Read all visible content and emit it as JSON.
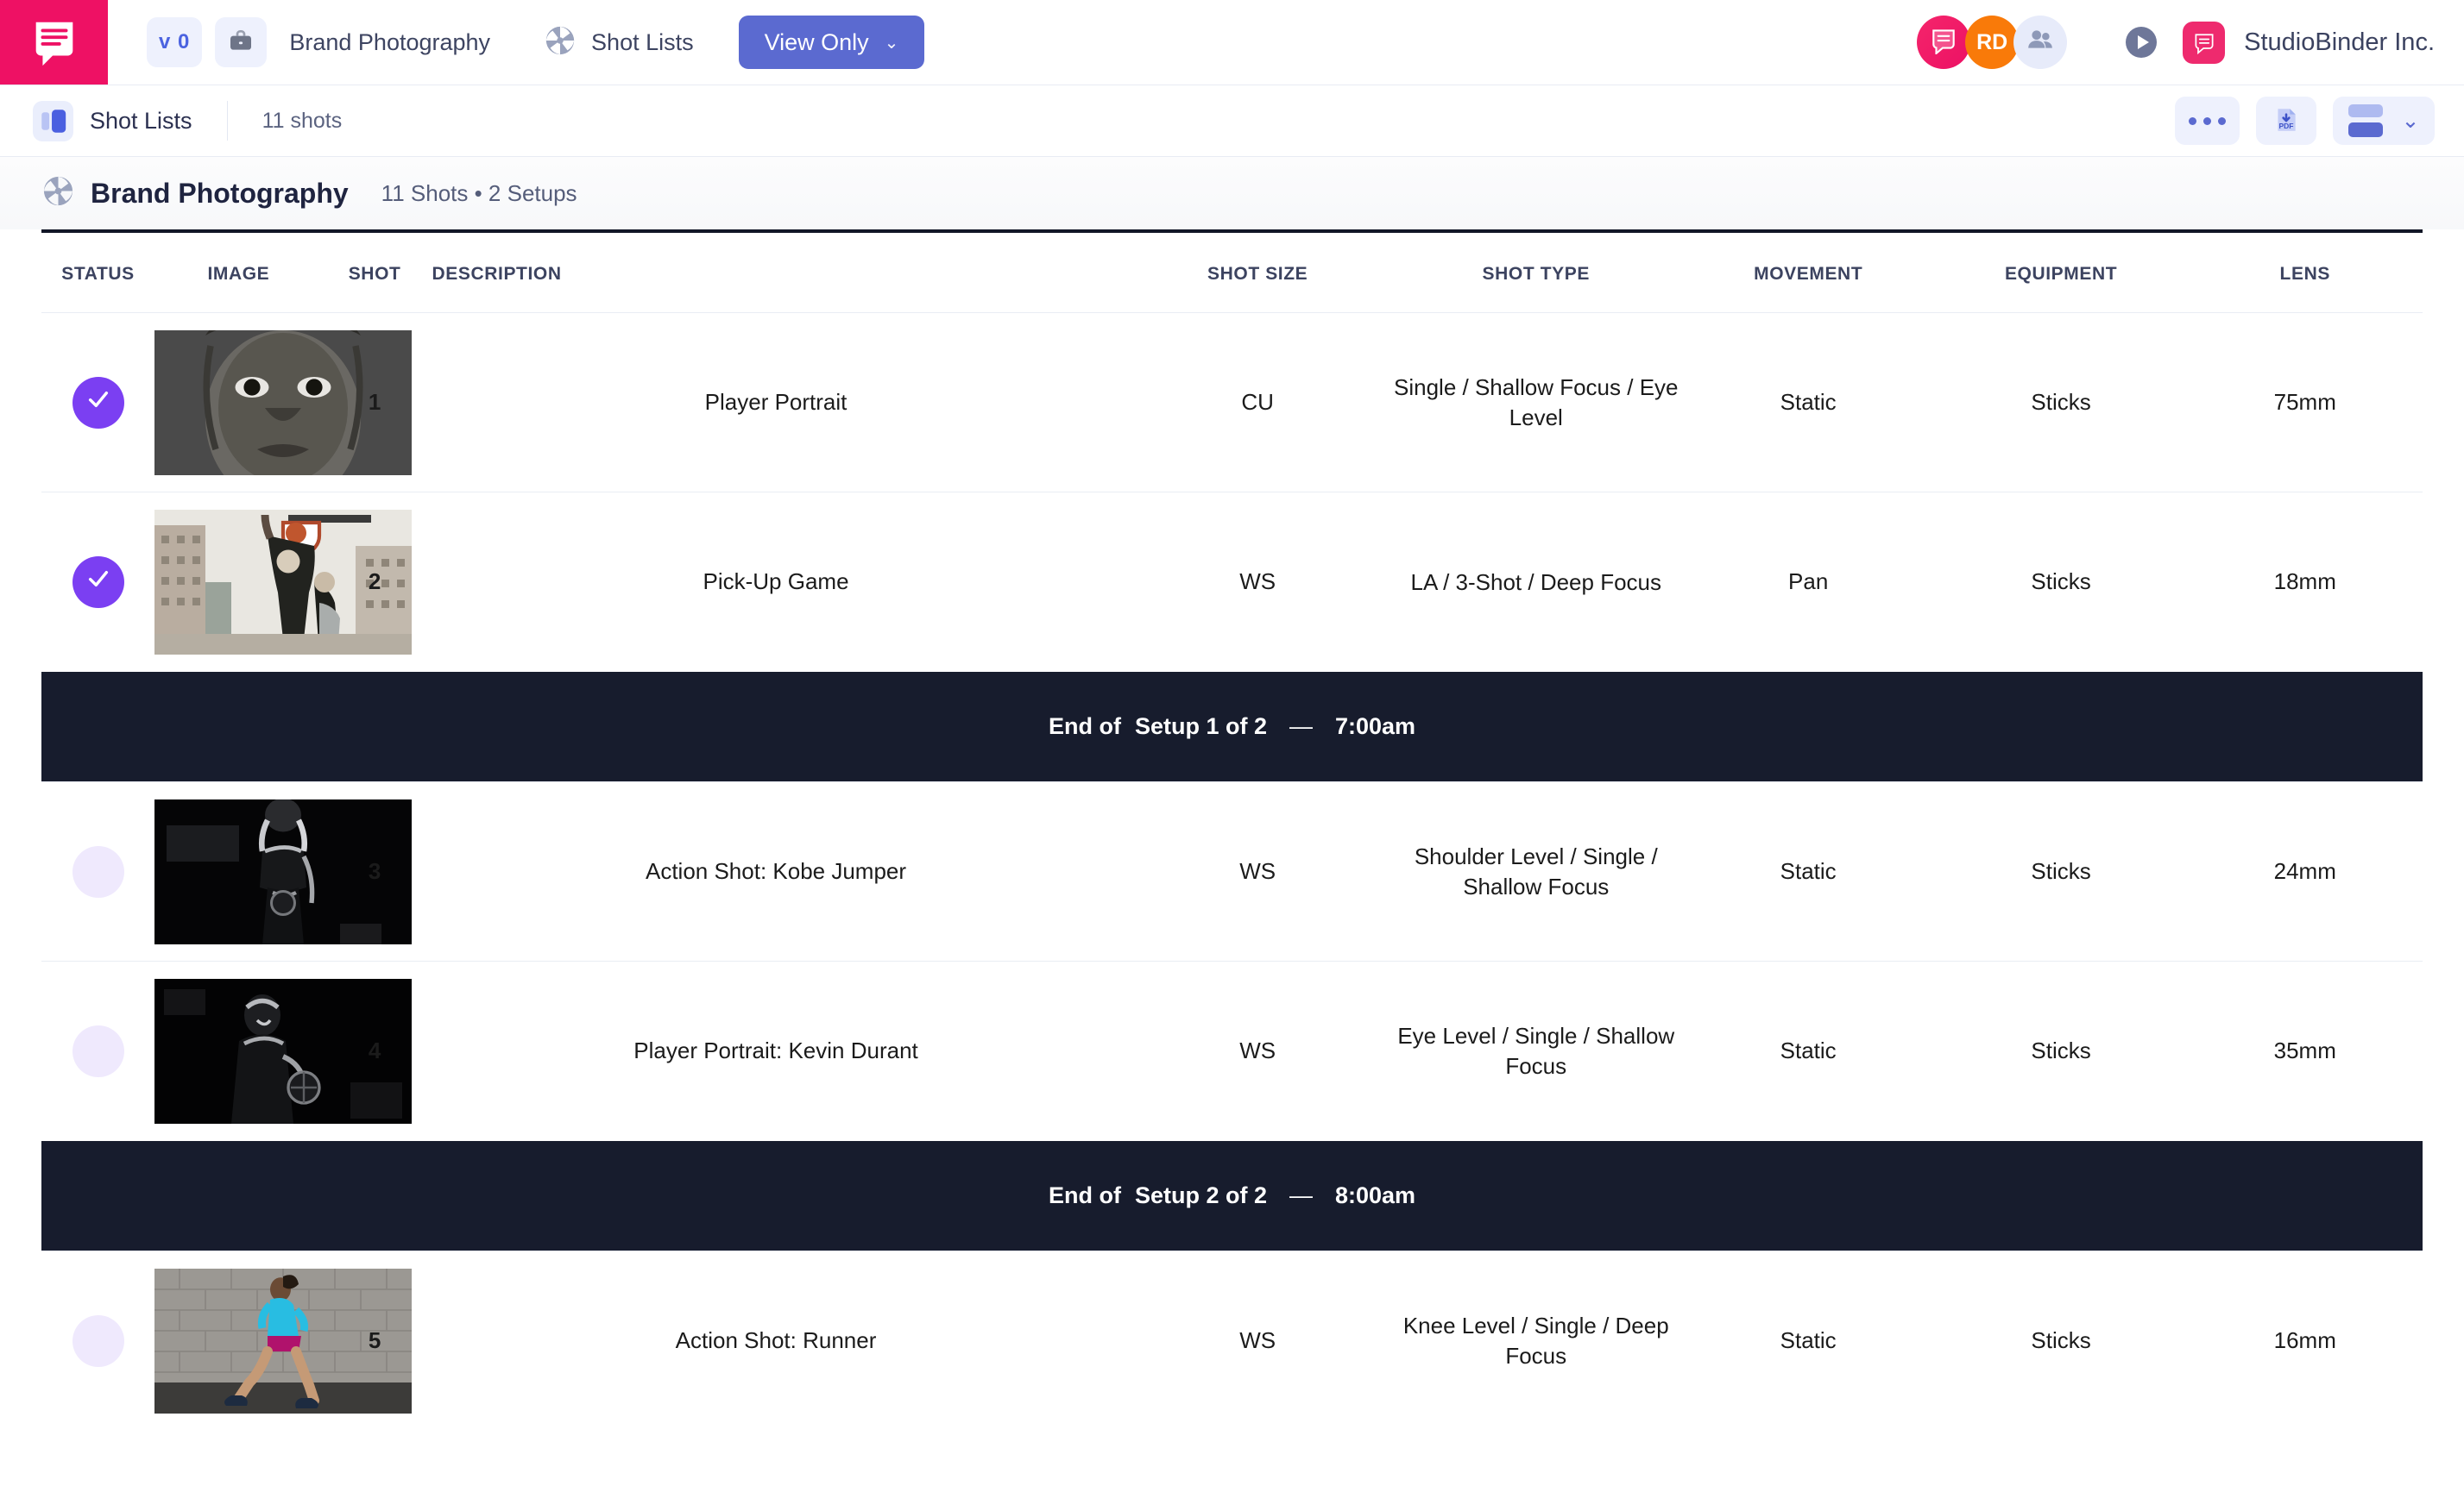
{
  "topbar": {
    "logo_icon": "studiobinder-speech-logo",
    "version_badge": "v 0",
    "project_icon": "briefcase-icon",
    "project_name": "Brand Photography",
    "section_icon": "aperture-icon",
    "section_name": "Shot Lists",
    "view_mode_button": "View Only",
    "view_mode_caret": "⌄",
    "avatars": [
      {
        "name": "avatar-notification",
        "initials": "",
        "color": "#ec1164",
        "icon": "speech-bubble-icon"
      },
      {
        "name": "avatar-user-rd",
        "initials": "RD",
        "color": "#f97a09",
        "icon": ""
      },
      {
        "name": "avatar-team",
        "initials": "",
        "color": "#e7ebfa",
        "icon": "people-icon"
      }
    ],
    "play_icon": "play-circle-icon",
    "brand_badge_icon": "studiobinder-badge-icon",
    "company_name": "StudioBinder Inc."
  },
  "subbar": {
    "icon": "shot-list-icon",
    "title": "Shot Lists",
    "count": "11 shots",
    "actions": [
      {
        "name": "more-options-button",
        "icon": "ellipsis-icon"
      },
      {
        "name": "export-pdf-button",
        "icon": "pdf-download-icon",
        "label": "PDF"
      },
      {
        "name": "view-layout-button",
        "icon": "layout-rows-icon",
        "caret": "⌄"
      }
    ]
  },
  "project_header": {
    "icon": "aperture-icon",
    "title": "Brand Photography",
    "meta": "11 Shots • 2 Setups"
  },
  "table": {
    "columns": [
      "STATUS",
      "IMAGE",
      "SHOT",
      "DESCRIPTION",
      "SHOT SIZE",
      "SHOT TYPE",
      "MOVEMENT",
      "EQUIPMENT",
      "LENS"
    ],
    "rows": [
      {
        "kind": "shot",
        "status": "done",
        "image": "close-up-portrait-bw",
        "shot": "1",
        "description": "Player Portrait",
        "shot_size": "CU",
        "shot_type": "Single / Shallow Focus / Eye Level",
        "movement": "Static",
        "equipment": "Sticks",
        "lens": "75mm"
      },
      {
        "kind": "shot",
        "status": "done",
        "image": "basketball-dunk-city",
        "shot": "2",
        "description": "Pick-Up Game",
        "shot_size": "WS",
        "shot_type": "LA / 3-Shot / Deep Focus",
        "movement": "Pan",
        "equipment": "Sticks",
        "lens": "18mm"
      },
      {
        "kind": "setup",
        "prefix": "End of",
        "label": "Setup 1 of 2",
        "dash": "—",
        "time": "7:00am"
      },
      {
        "kind": "shot",
        "status": "todo",
        "image": "kobe-jumper-dark",
        "shot": "3",
        "description": "Action Shot: Kobe Jumper",
        "shot_size": "WS",
        "shot_type": "Shoulder Level / Single / Shallow Focus",
        "movement": "Static",
        "equipment": "Sticks",
        "lens": "24mm"
      },
      {
        "kind": "shot",
        "status": "todo",
        "image": "durant-portrait-dark",
        "shot": "4",
        "description": "Player Portrait: Kevin Durant",
        "shot_size": "WS",
        "shot_type": "Eye Level / Single / Shallow Focus",
        "movement": "Static",
        "equipment": "Sticks",
        "lens": "35mm"
      },
      {
        "kind": "setup",
        "prefix": "End of",
        "label": "Setup 2 of 2",
        "dash": "—",
        "time": "8:00am"
      },
      {
        "kind": "shot",
        "status": "todo",
        "image": "runner-brick-wall",
        "shot": "5",
        "description": "Action Shot: Runner",
        "shot_size": "WS",
        "shot_type": "Knee Level / Single / Deep Focus",
        "movement": "Static",
        "equipment": "Sticks",
        "lens": "16mm"
      }
    ]
  },
  "colors": {
    "brand_pink": "#ee1164",
    "accent_blue": "#5b6ad0",
    "status_done": "#7b3ff2",
    "status_todo": "#efe9fd",
    "setup_bar": "#171c2d"
  }
}
